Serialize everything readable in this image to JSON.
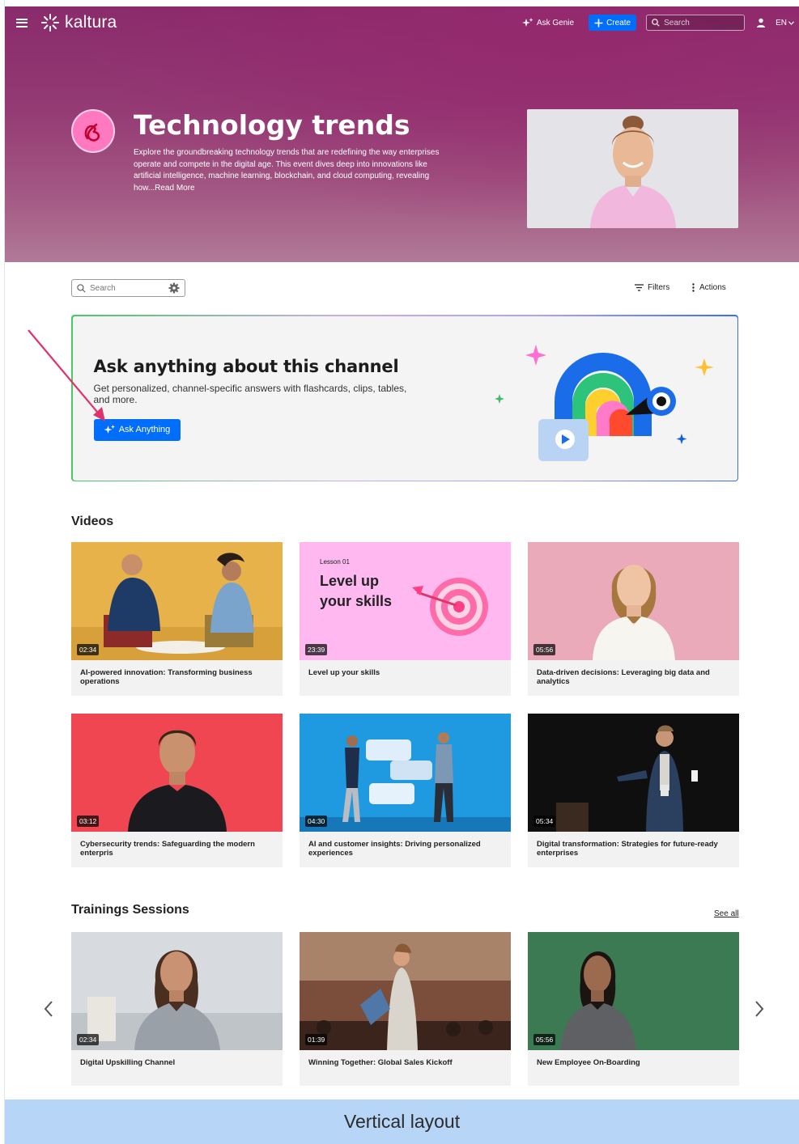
{
  "nav": {
    "logo_text": "kaltura",
    "ask_genie": "Ask Genie",
    "create": "Create",
    "search_placeholder": "Search",
    "lang": "EN"
  },
  "hero": {
    "title": "Technology trends",
    "description": "Explore the groundbreaking technology trends that are redefining the way enterprises operate and compete in the digital age. This event dives deep into innovations like artificial intelligence, machine learning, blockchain, and cloud computing, revealing how...Read More"
  },
  "toolbar": {
    "search_placeholder": "Search",
    "filters": "Filters",
    "actions": "Actions"
  },
  "ask": {
    "title": "Ask anything about this channel",
    "subtitle": "Get personalized, channel-specific answers with flashcards, clips, tables, and more.",
    "button": "Ask Anything"
  },
  "videos": {
    "title": "Videos",
    "items": [
      {
        "duration": "02:34",
        "title": "AI-powered innovation: Transforming business operations"
      },
      {
        "duration": "23:39",
        "title": "Level up your skills",
        "thumb_small": "Lesson 01",
        "thumb_line1": "Level up",
        "thumb_line2": "your skills"
      },
      {
        "duration": "05:56",
        "title": "Data-driven decisions: Leveraging big data and analytics"
      },
      {
        "duration": "03:12",
        "title": "Cybersecurity trends: Safeguarding the modern enterpris"
      },
      {
        "duration": "04:30",
        "title": "AI and customer insights: Driving personalized experiences"
      },
      {
        "duration": "05:34",
        "title": "Digital transformation: Strategies for future-ready enterprises"
      }
    ]
  },
  "trainings": {
    "title": "Trainings Sessions",
    "see_all": "See all",
    "items": [
      {
        "duration": "02:34",
        "title": "Digital Upskilling Channel"
      },
      {
        "duration": "01:39",
        "title": "Winning Together: Global Sales Kickoff"
      },
      {
        "duration": "05:56",
        "title": "New Employee On-Boarding"
      }
    ]
  },
  "footer_label": "Vertical layout",
  "colors": {
    "accent": "#006efa",
    "hero": "#8a2b6b",
    "footer": "#b7d5f7",
    "arrow": "#e0336e"
  }
}
